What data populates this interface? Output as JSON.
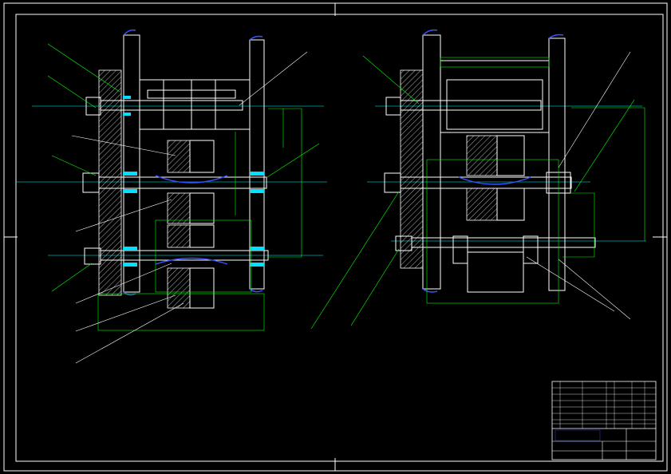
{
  "drawing": {
    "left_view_caption": "",
    "right_view_caption": "",
    "notes_heading": "",
    "notes": [
      "",
      "",
      "",
      "",
      "",
      ""
    ]
  },
  "title_block": {
    "drawing_title": "",
    "scale": "",
    "sheet": ""
  },
  "colors": {
    "background": "#000000",
    "outline": "#ffffff",
    "leader": "#00ff00",
    "centerline": "#00ffff",
    "edge": "#3a52ff"
  }
}
